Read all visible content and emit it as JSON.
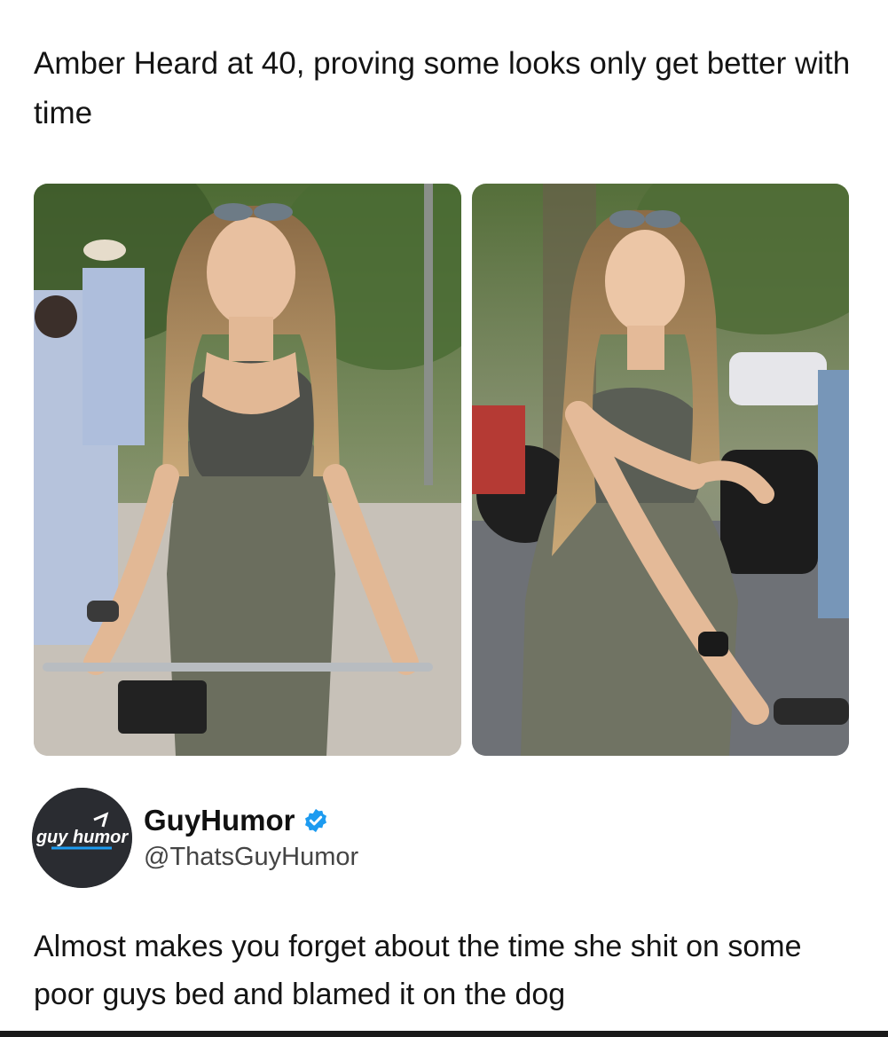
{
  "quoted_post": {
    "text": "Amber Heard at 40, proving some looks only get better with time"
  },
  "author": {
    "avatar_text": "guy humor",
    "name": "GuyHumor",
    "handle": "@ThatsGuyHumor",
    "verified_color": "#1d9bf0"
  },
  "tweet": {
    "text": "Almost makes you forget about the time she shit on some poor guys bed and blamed it on the dog"
  },
  "colors": {
    "background": "#ffffff",
    "text": "#141414",
    "avatar_bg": "#2a2c31"
  }
}
